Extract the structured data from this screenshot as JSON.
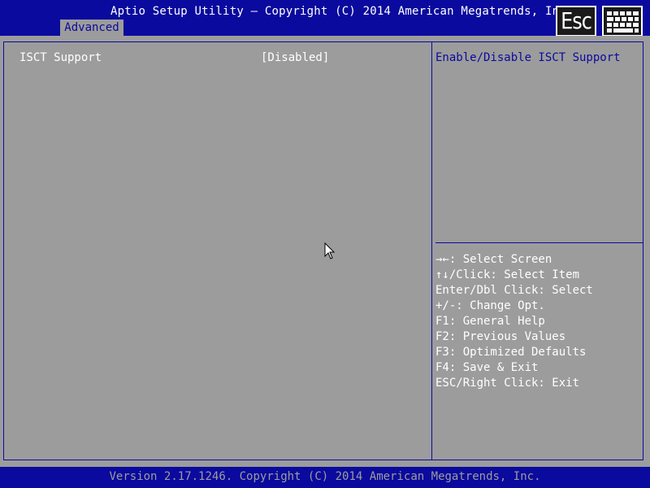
{
  "header": {
    "title": "Aptio Setup Utility – Copyright (C) 2014 American Megatrends, Inc.",
    "tabs": [
      {
        "label": "Advanced",
        "selected": true
      }
    ],
    "esc_label": "Esc",
    "icons": [
      "esc-icon",
      "keyboard-icon"
    ]
  },
  "settings": [
    {
      "label": "ISCT Support",
      "value": "[Disabled]"
    }
  ],
  "help": {
    "description": "Enable/Disable ISCT Support",
    "keys": [
      "→←: Select Screen",
      "↑↓/Click: Select Item",
      "Enter/Dbl Click: Select",
      "+/-: Change Opt.",
      "F1: General Help",
      "F2: Previous Values",
      "F3: Optimized Defaults",
      "F4: Save & Exit",
      "ESC/Right Click: Exit"
    ]
  },
  "footer": {
    "version": "Version 2.17.1246. Copyright (C) 2014 American Megatrends, Inc."
  },
  "colors": {
    "background_blue": "#0a0a9e",
    "panel_gray": "#9c9c9c",
    "text_white": "#ffffff"
  }
}
